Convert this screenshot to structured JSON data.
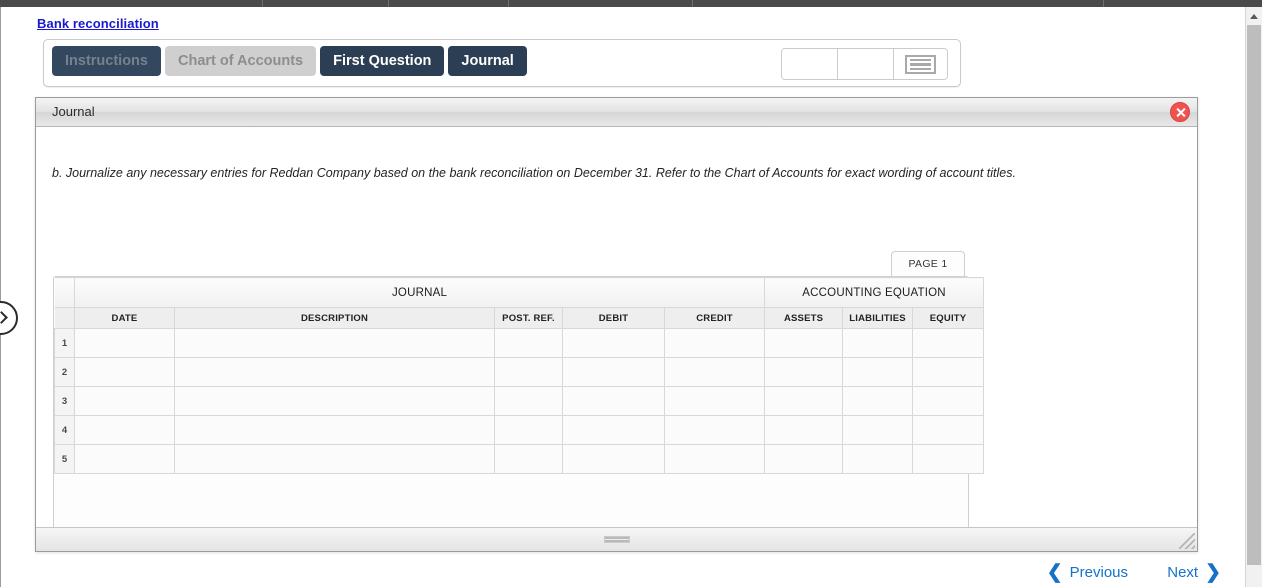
{
  "breadcrumb": {
    "label": "Bank reconciliation"
  },
  "tabs": [
    {
      "label": "Instructions",
      "state": "dark-disabled"
    },
    {
      "label": "Chart of Accounts",
      "state": "light-disabled"
    },
    {
      "label": "First Question",
      "state": "active"
    },
    {
      "label": "Journal",
      "state": "active"
    }
  ],
  "toolbar": {
    "field_one": "",
    "field_two": "",
    "grid_icon": "grid-menu-icon"
  },
  "panel": {
    "title": "Journal",
    "close_label": "×",
    "question": "b. Journalize any necessary entries for Reddan Company based on the bank reconciliation on December 31. Refer to the Chart of Accounts for exact wording of account titles."
  },
  "page_tab": {
    "label": "PAGE 1"
  },
  "table": {
    "group_headers": [
      {
        "label": "JOURNAL"
      },
      {
        "label": "ACCOUNTING EQUATION"
      }
    ],
    "columns": [
      "DATE",
      "DESCRIPTION",
      "POST. REF.",
      "DEBIT",
      "CREDIT",
      "ASSETS",
      "LIABILITIES",
      "EQUITY"
    ],
    "rows": [
      {
        "num": "1",
        "date": "",
        "description": "",
        "post_ref": "",
        "debit": "",
        "credit": "",
        "assets": "",
        "liabilities": "",
        "equity": ""
      },
      {
        "num": "2",
        "date": "",
        "description": "",
        "post_ref": "",
        "debit": "",
        "credit": "",
        "assets": "",
        "liabilities": "",
        "equity": ""
      },
      {
        "num": "3",
        "date": "",
        "description": "",
        "post_ref": "",
        "debit": "",
        "credit": "",
        "assets": "",
        "liabilities": "",
        "equity": ""
      },
      {
        "num": "4",
        "date": "",
        "description": "",
        "post_ref": "",
        "debit": "",
        "credit": "",
        "assets": "",
        "liabilities": "",
        "equity": ""
      },
      {
        "num": "5",
        "date": "",
        "description": "",
        "post_ref": "",
        "debit": "",
        "credit": "",
        "assets": "",
        "liabilities": "",
        "equity": ""
      }
    ]
  },
  "bottom_nav": {
    "previous_label": "Previous",
    "next_label": "Next",
    "prev_chevron": "❮",
    "next_chevron": "❯"
  },
  "colors": {
    "link": "#1919d0",
    "tab_active_bg": "#2b3e54",
    "tab_dark_disabled_bg": "#33475e",
    "tab_light_disabled_bg": "#cfcfcf",
    "close_red": "#ef5350",
    "nav_blue": "#1472c9"
  }
}
